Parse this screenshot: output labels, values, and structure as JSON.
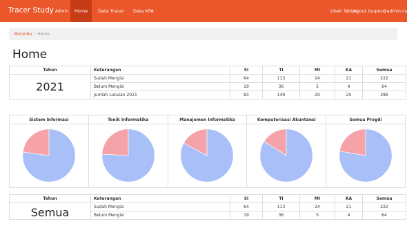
{
  "navbar": {
    "brand": "Tracer Study",
    "brand_sub": "Admin",
    "items": [
      "Home",
      "Data Tracer",
      "Data KPA"
    ],
    "right_items": [
      "Ubah Tahun",
      "Logout (super@admin.com)"
    ]
  },
  "breadcrumb": {
    "home": "Beranda",
    "separator": "/",
    "current": "Home"
  },
  "page_title": "Home",
  "table_headers": [
    "Tahun",
    "Keterangan",
    "SI",
    "TI",
    "MI",
    "KA",
    "Semua"
  ],
  "table_2021": {
    "year": "2021",
    "rows": [
      {
        "label": "Sudah Mengisi",
        "values": [
          "64",
          "113",
          "24",
          "21",
          "222"
        ]
      },
      {
        "label": "Belum Mengisi",
        "values": [
          "19",
          "36",
          "5",
          "4",
          "64"
        ]
      },
      {
        "label": "Jumlah Lulusan 2021",
        "values": [
          "83",
          "149",
          "29",
          "25",
          "286"
        ]
      }
    ]
  },
  "charts": [
    {
      "title": "Sistem Informasi",
      "filled": 64,
      "unfilled": 19
    },
    {
      "title": "Tenik Informatika",
      "filled": 113,
      "unfilled": 36
    },
    {
      "title": "Manajemen Informatika",
      "filled": 24,
      "unfilled": 5
    },
    {
      "title": "Komputerisasi Akuntansi",
      "filled": 21,
      "unfilled": 4
    },
    {
      "title": "Semua Progdi",
      "filled": 222,
      "unfilled": 64
    }
  ],
  "chart_colors": {
    "filled": "#a9bff8",
    "unfilled": "#f5a3a8"
  },
  "table_semua": {
    "year": "Semua",
    "rows": [
      {
        "label": "Sudah Mengisi",
        "values": [
          "64",
          "113",
          "24",
          "21",
          "222"
        ]
      },
      {
        "label": "Belum Mengisi",
        "values": [
          "19",
          "36",
          "5",
          "4",
          "64"
        ]
      }
    ]
  }
}
